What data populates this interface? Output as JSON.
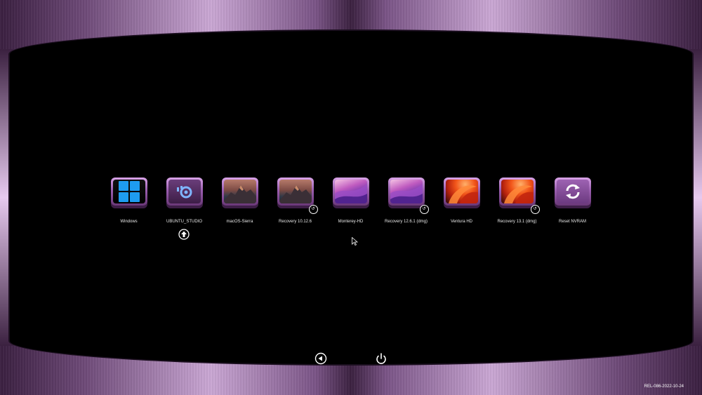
{
  "boot_entries": [
    {
      "label": "Windows",
      "icon": "windows-logo-icon"
    },
    {
      "label": "UBUNTU_STUDIO",
      "icon": "ubuntu-studio-icon"
    },
    {
      "label": "macOS-Sierra",
      "icon": "macos-sierra-icon"
    },
    {
      "label": "Recovery 10.12.6",
      "icon": "macos-sierra-recovery-icon"
    },
    {
      "label": "Monterey-HD",
      "icon": "macos-monterey-icon"
    },
    {
      "label": "Recovery 12.6.1 (dmg)",
      "icon": "macos-monterey-recovery-icon"
    },
    {
      "label": "Ventura HD",
      "icon": "macos-ventura-icon"
    },
    {
      "label": "Recovery 13.1 (dmg)",
      "icon": "macos-ventura-recovery-icon"
    },
    {
      "label": "Reset NVRAM",
      "icon": "reset-nvram-icon"
    }
  ],
  "controls": {
    "left": "back-arrow-icon",
    "right": "power-icon"
  },
  "version": "REL-086-2022-10-24",
  "colors": {
    "frame_accent": "#caa7d4",
    "tile_top": "#d9a3e8",
    "tile_bottom": "#6a3878"
  }
}
